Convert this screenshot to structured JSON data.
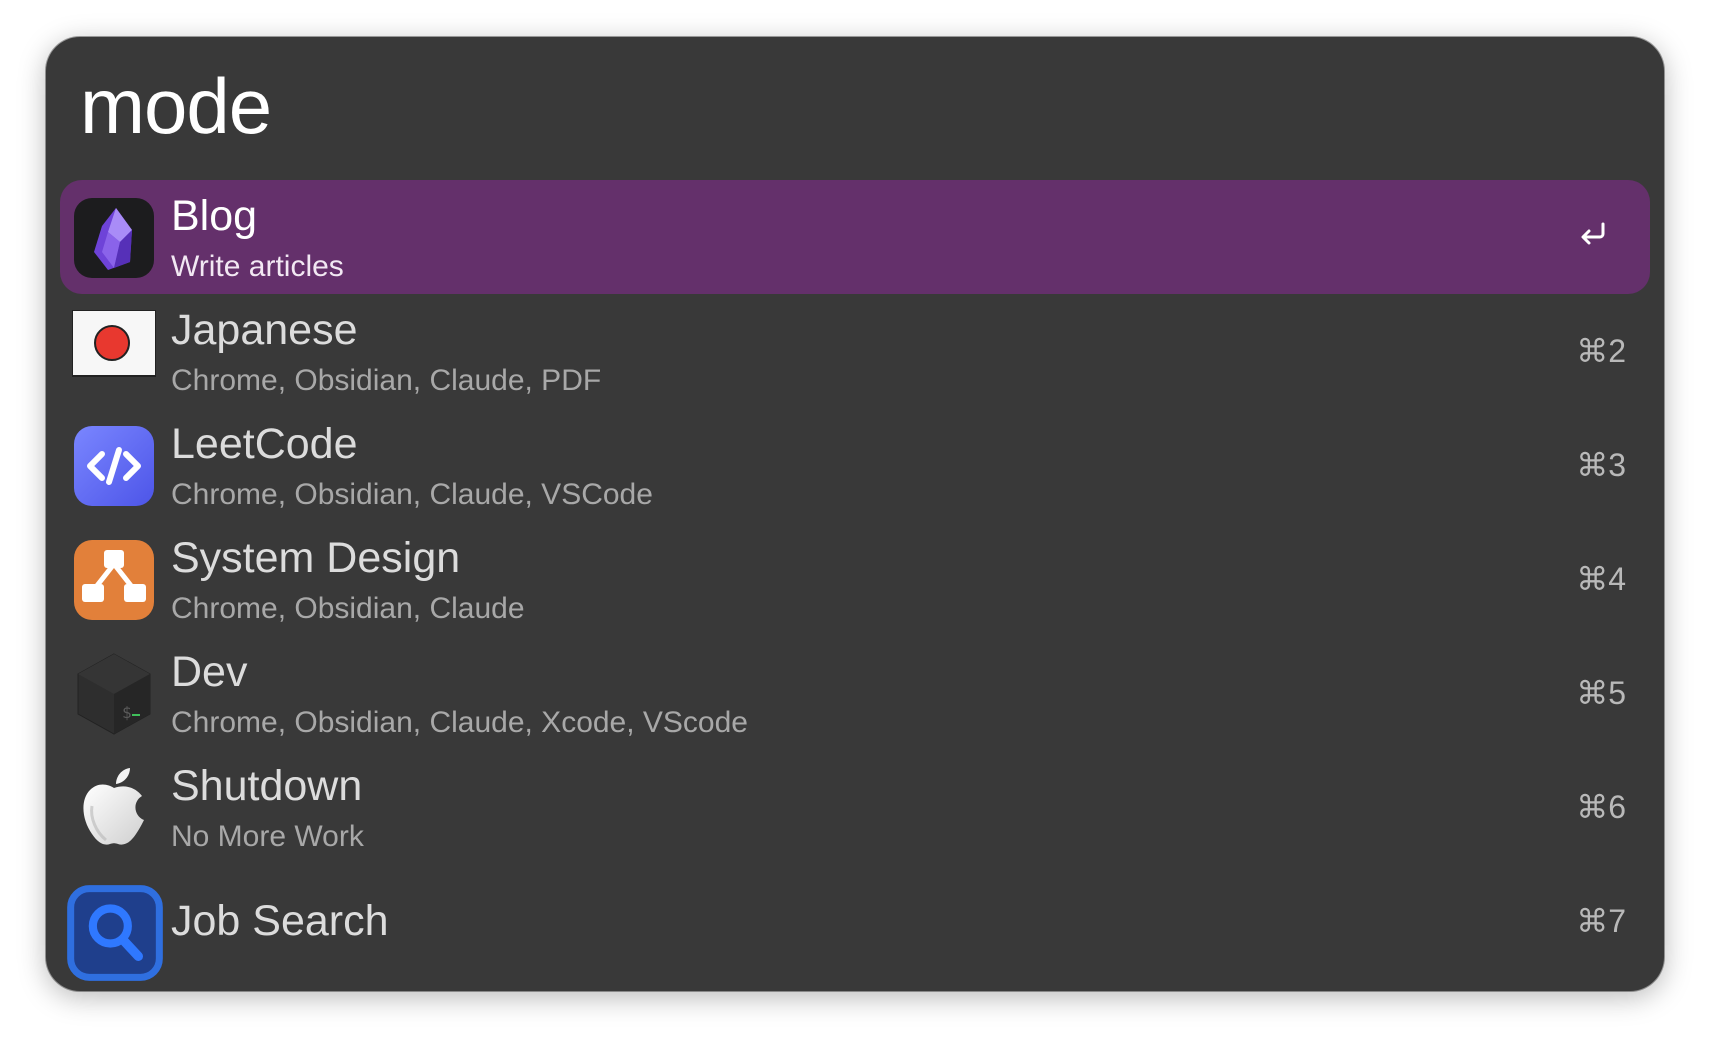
{
  "search": {
    "query": "mode"
  },
  "results": [
    {
      "title": "Blog",
      "subtitle": "Write articles",
      "shortcut": "",
      "icon": "obsidian-icon",
      "selected": true
    },
    {
      "title": "Japanese",
      "subtitle": "Chrome, Obsidian, Claude, PDF",
      "shortcut": "⌘2",
      "icon": "japan-flag-icon"
    },
    {
      "title": "LeetCode",
      "subtitle": "Chrome, Obsidian, Claude, VSCode",
      "shortcut": "⌘3",
      "icon": "code-icon"
    },
    {
      "title": "System Design",
      "subtitle": "Chrome, Obsidian, Claude",
      "shortcut": "⌘4",
      "icon": "diagram-icon"
    },
    {
      "title": "Dev",
      "subtitle": "Chrome, Obsidian, Claude, Xcode, VScode",
      "shortcut": "⌘5",
      "icon": "terminal-icon"
    },
    {
      "title": "Shutdown",
      "subtitle": "No More Work",
      "shortcut": "⌘6",
      "icon": "apple-icon"
    },
    {
      "title": "Job Search",
      "subtitle": "",
      "shortcut": "⌘7",
      "icon": "magnifier-icon"
    }
  ],
  "colors": {
    "window_bg": "#393939",
    "selected_bg": "#64306b",
    "title_text": "#dcdcdc",
    "subtitle_text": "#a8a8a8"
  }
}
